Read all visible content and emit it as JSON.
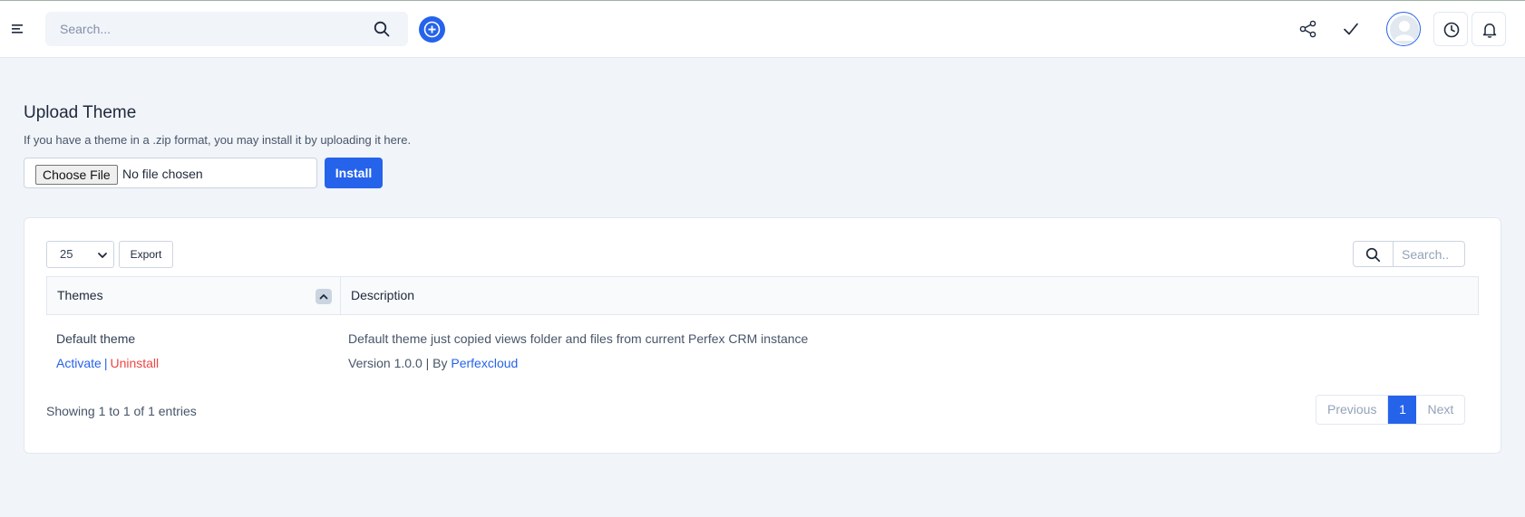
{
  "header": {
    "search_placeholder": "Search..."
  },
  "upload": {
    "title": "Upload Theme",
    "help_text": "If you have a theme in a .zip format, you may install it by uploading it here.",
    "choose_file_label": "Choose File",
    "no_file_text": "No file chosen",
    "install_label": "Install"
  },
  "table": {
    "page_size": "25",
    "export_label": "Export",
    "search_placeholder": "Search..",
    "columns": [
      "Themes",
      "Description"
    ],
    "rows": [
      {
        "name": "Default theme",
        "activate_label": "Activate",
        "separator": "|",
        "uninstall_label": "Uninstall",
        "description": "Default theme just copied views folder and files from current Perfex CRM instance",
        "version_prefix": "Version 1.0.0 | By ",
        "author": "Perfexcloud"
      }
    ],
    "entries_info": "Showing 1 to 1 of 1 entries",
    "pagination": {
      "previous_label": "Previous",
      "current_page": "1",
      "next_label": "Next"
    }
  },
  "colors": {
    "primary": "#2563eb",
    "danger": "#ef4444",
    "page_background": "#f1f4f9"
  },
  "icons": [
    "menu-icon",
    "search-icon",
    "plus-icon",
    "share-icon",
    "check-icon",
    "avatar-icon",
    "clock-icon",
    "bell-icon",
    "chevron-down-icon",
    "sort-up-icon"
  ]
}
